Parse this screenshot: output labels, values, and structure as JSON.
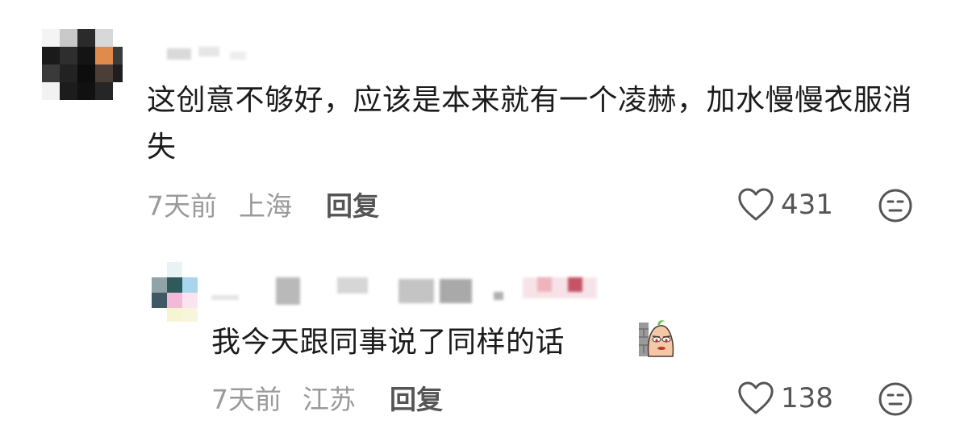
{
  "comments": [
    {
      "text": "这创意不够好，应该是本来就有一个凌赫，加水慢慢衣服消失",
      "time": "7天前",
      "location": "上海",
      "reply_label": "回复",
      "likes": "431"
    },
    {
      "text": "我今天跟同事说了同样的话",
      "time": "7天前",
      "location": "江苏",
      "reply_label": "回复",
      "likes": "138"
    }
  ],
  "icons": {
    "like": "heart-outline-icon",
    "dislike": "neutral-face-icon",
    "sticker": "peeking-bean-sticker"
  },
  "colors": {
    "text": "#1b1b1b",
    "meta": "#9a9a9a",
    "action": "#555555"
  }
}
